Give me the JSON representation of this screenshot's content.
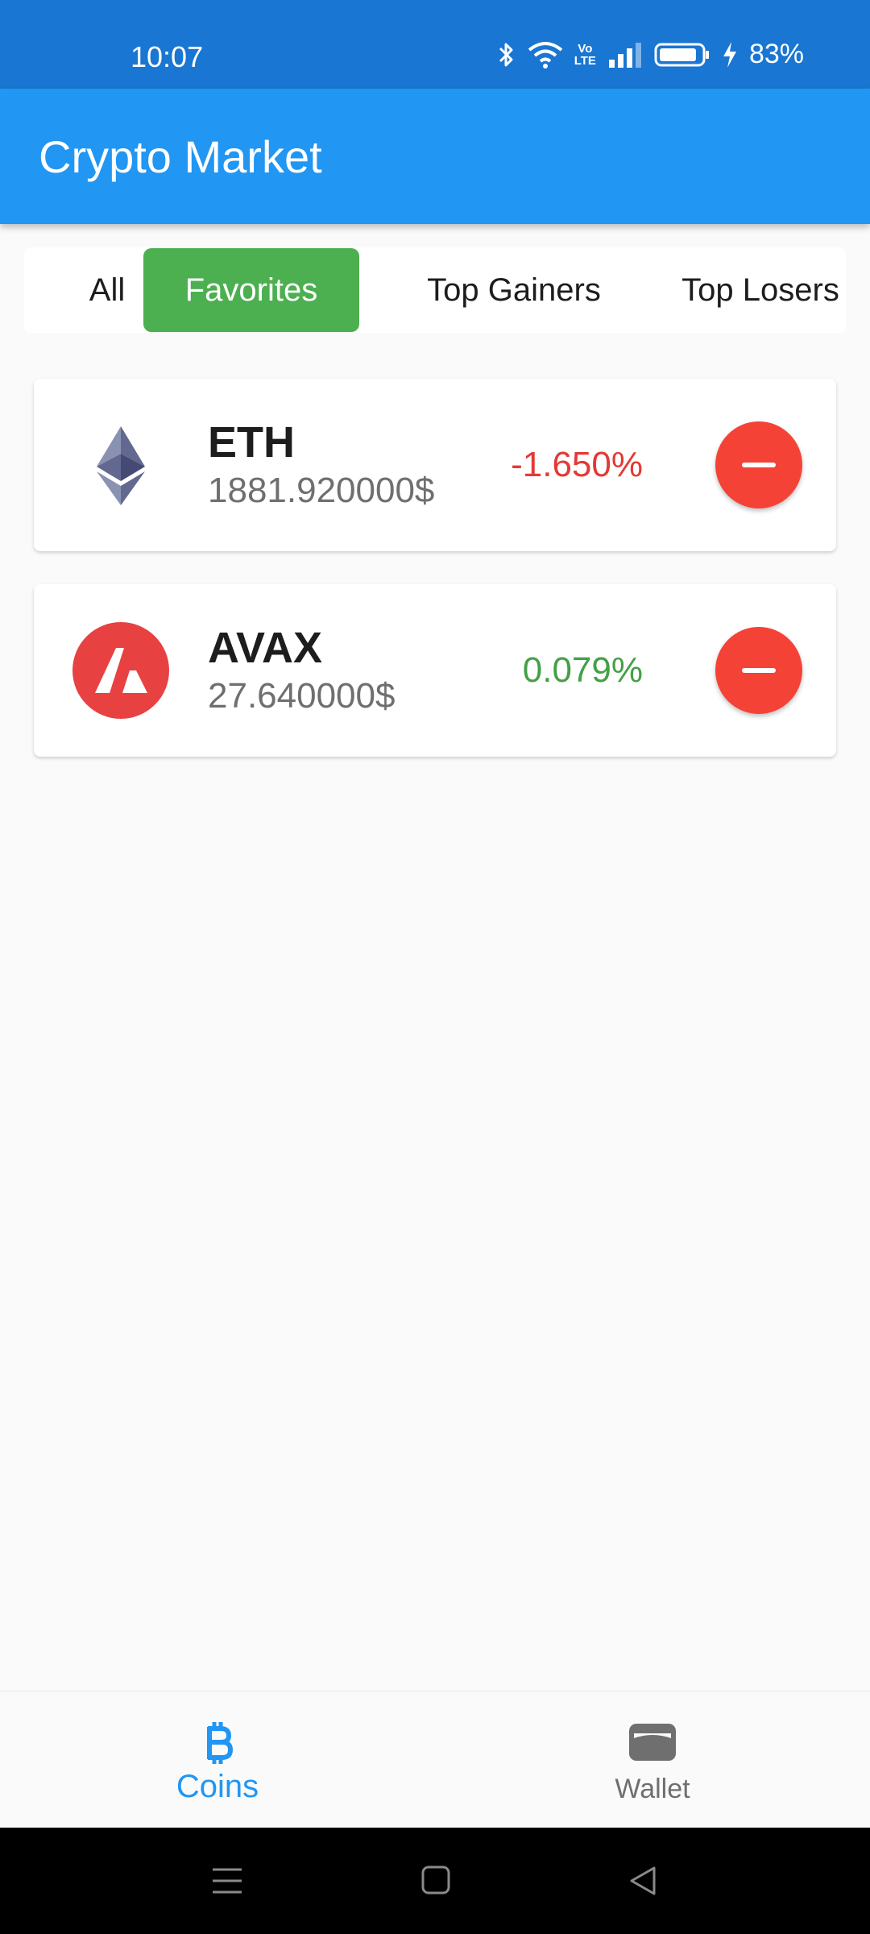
{
  "status_bar": {
    "time": "10:07",
    "battery": "83%"
  },
  "app_bar": {
    "title": "Crypto Market"
  },
  "tabs": [
    {
      "label": "All",
      "active": false
    },
    {
      "label": "Favorites",
      "active": true
    },
    {
      "label": "Top Gainers",
      "active": false
    },
    {
      "label": "Top Losers",
      "active": false
    }
  ],
  "coins": [
    {
      "symbol": "ETH",
      "price": "1881.920000$",
      "change": "-1.650%",
      "change_color": "#e53935",
      "icon": "ethereum-icon"
    },
    {
      "symbol": "AVAX",
      "price": "27.640000$",
      "change": "0.079%",
      "change_color": "#43a047",
      "icon": "avalanche-icon"
    }
  ],
  "bottom_nav": {
    "coins_label": "Coins",
    "wallet_label": "Wallet",
    "active_color": "#2196f3",
    "inactive_color": "#6f6f6f"
  },
  "colors": {
    "status": "#1976d2",
    "primary": "#2196f3",
    "favorites": "#4caf50",
    "remove": "#f44336"
  }
}
